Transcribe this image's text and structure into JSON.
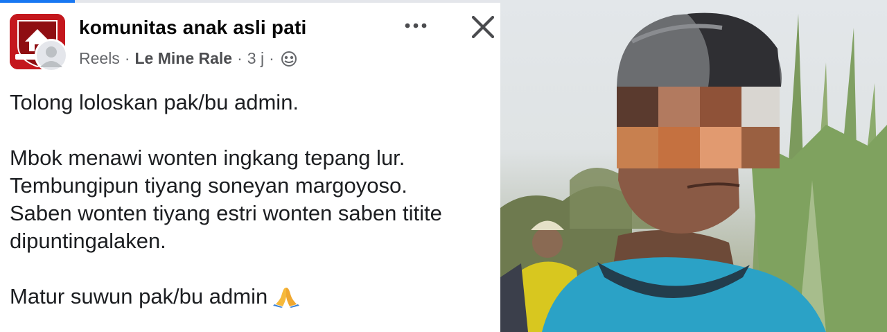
{
  "post": {
    "group_name": "komunitas anak asli pati",
    "meta": {
      "source": "Reels",
      "separator": "·",
      "author": "Le Mine Rale",
      "time": "3 j"
    },
    "icons": {
      "more": "more-options-icon",
      "close": "close-icon",
      "audience": "public-globe-icon",
      "group_avatar": "group-logo-icon",
      "user_avatar": "user-avatar-icon",
      "emoji": "folded-hands-emoji"
    },
    "body": {
      "line1": "Tolong loloskan pak/bu admin.",
      "line2": "Mbok menawi wonten ingkang tepang lur.",
      "line3": "Tembungipun tiyang soneyan margoyoso.",
      "line4": "Saben wonten tiyang estri wonten saben titite",
      "line5": "dipuntingalaken.",
      "line6": "Matur suwun pak/bu admin"
    }
  },
  "colors": {
    "accent": "#1877f2",
    "text": "#1c1e21",
    "secondary_text": "#65676b",
    "group_logo_red": "#c4171d"
  }
}
